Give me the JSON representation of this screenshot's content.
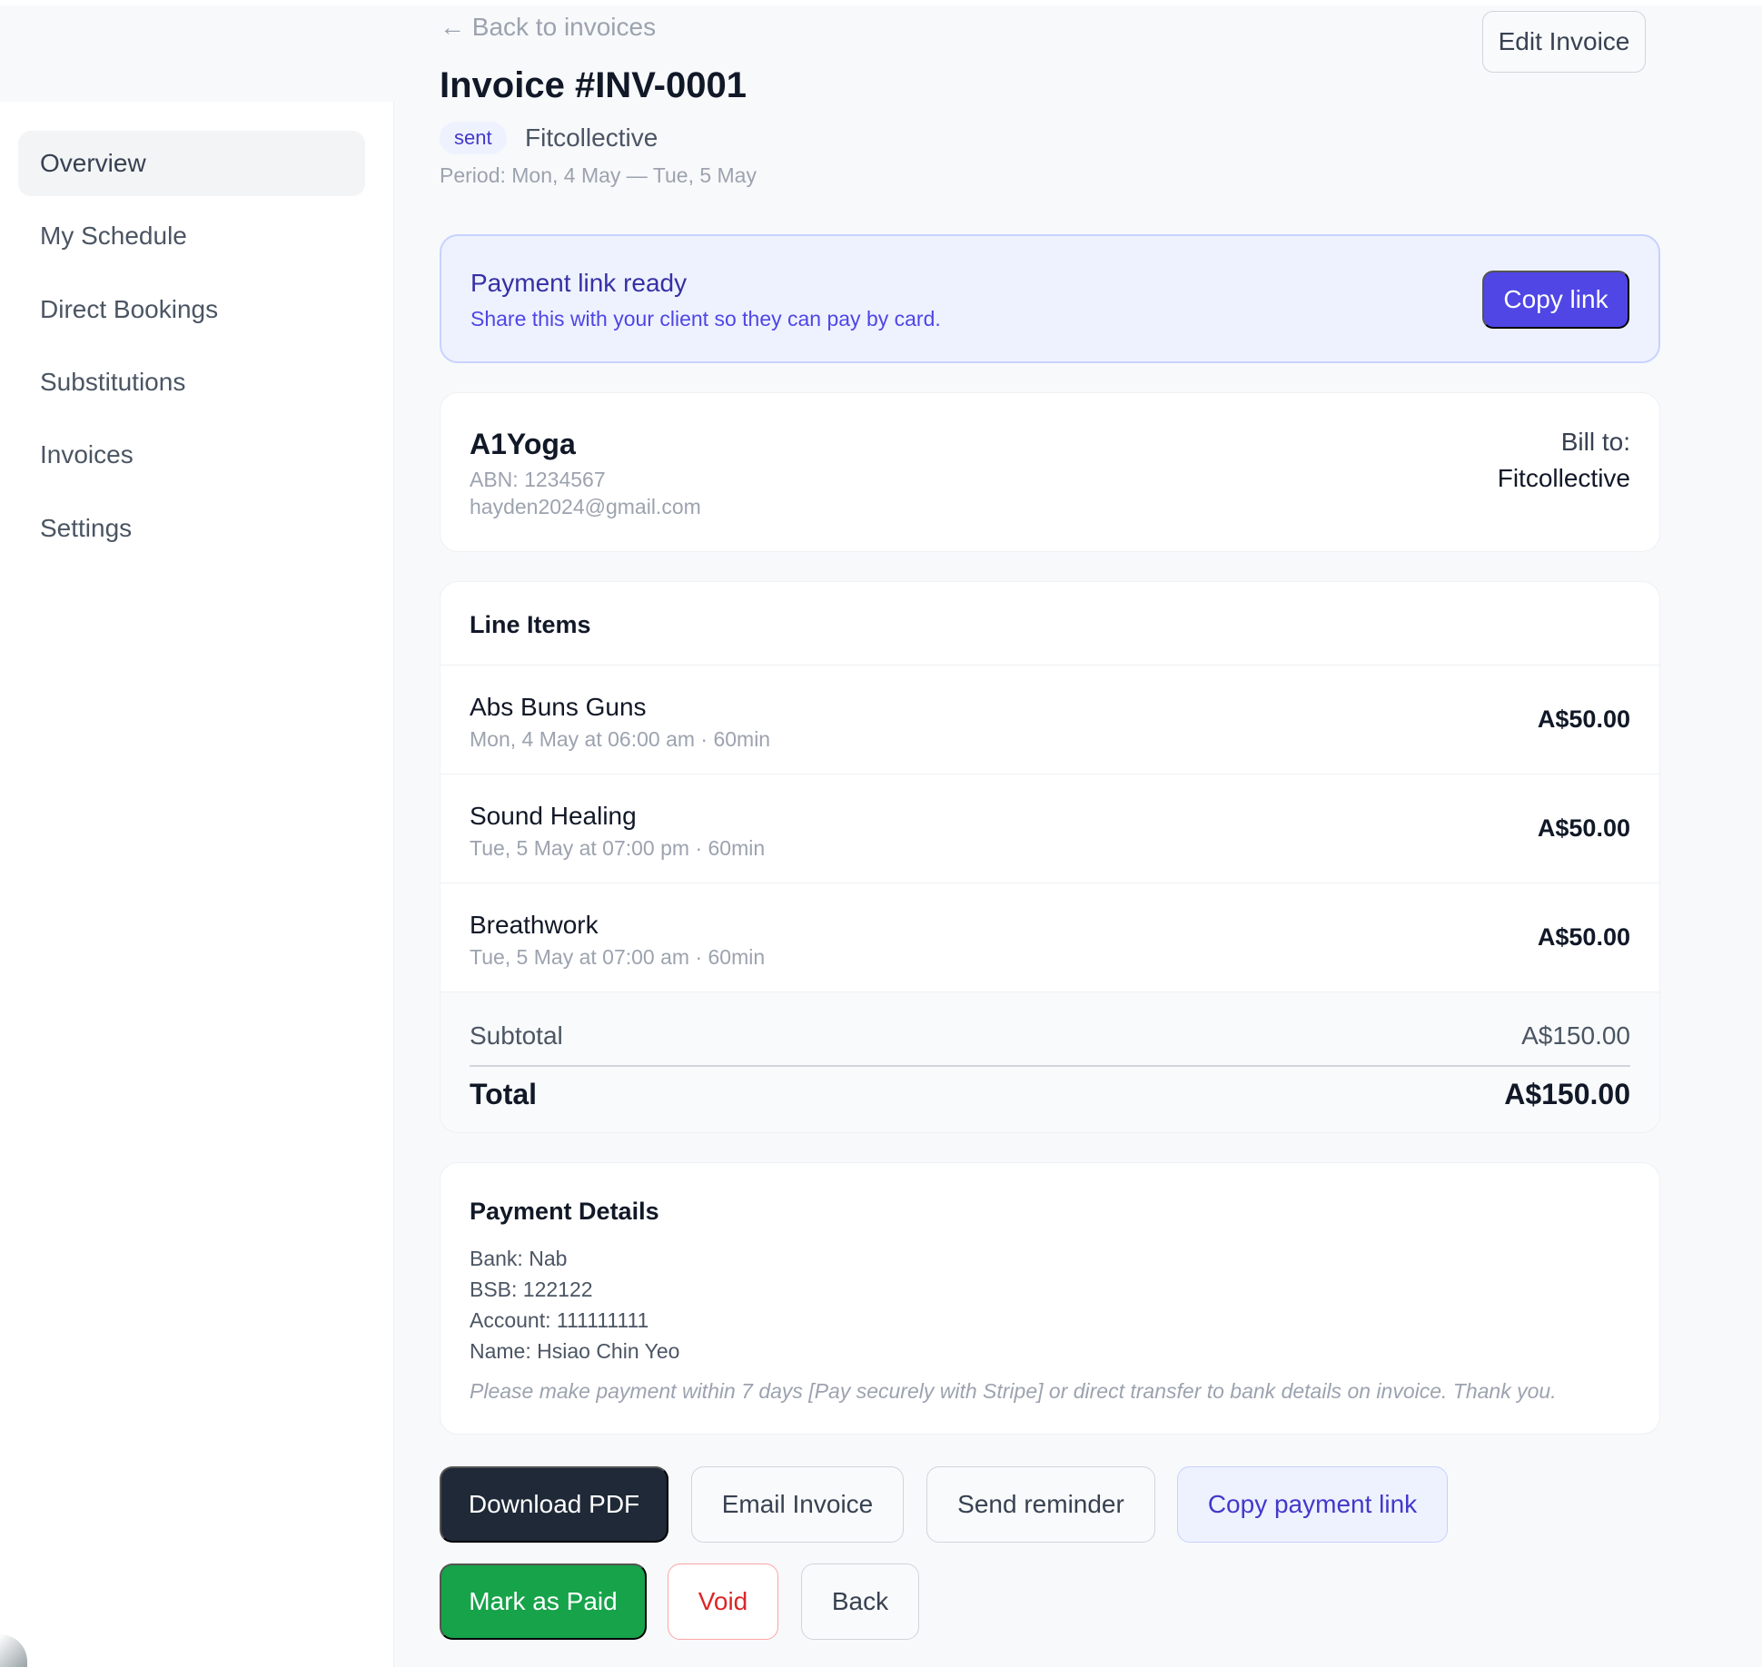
{
  "sidebar": {
    "items": [
      {
        "label": "Overview",
        "active": true
      },
      {
        "label": "My Schedule"
      },
      {
        "label": "Direct Bookings"
      },
      {
        "label": "Substitutions"
      },
      {
        "label": "Invoices"
      },
      {
        "label": "Settings"
      }
    ]
  },
  "header": {
    "back_label": "← Back to invoices",
    "edit_label": "Edit Invoice",
    "title": "Invoice #INV-0001",
    "status": "sent",
    "client": "Fitcollective",
    "period": "Period: Mon, 4 May — Tue, 5 May"
  },
  "banner": {
    "title": "Payment link ready",
    "subtitle": "Share this with your client so they can pay by card.",
    "button": "Copy link"
  },
  "business": {
    "name": "A1Yoga",
    "abn": "ABN: 1234567",
    "email": "hayden2024@gmail.com",
    "bill_label": "Bill to:",
    "bill_name": "Fitcollective"
  },
  "line_items": {
    "title": "Line Items",
    "items": [
      {
        "name": "Abs Buns Guns",
        "meta": "Mon, 4 May at 06:00 am · 60min",
        "amount": "A$50.00"
      },
      {
        "name": "Sound Healing",
        "meta": "Tue, 5 May at 07:00 pm · 60min",
        "amount": "A$50.00"
      },
      {
        "name": "Breathwork",
        "meta": "Tue, 5 May at 07:00 am · 60min",
        "amount": "A$50.00"
      }
    ],
    "subtotal_label": "Subtotal",
    "subtotal_value": "A$150.00",
    "total_label": "Total",
    "total_value": "A$150.00"
  },
  "payment": {
    "title": "Payment Details",
    "bank": "Bank: Nab",
    "bsb": "BSB: 122122",
    "account": "Account: 111111111",
    "name": "Name: Hsiao Chin Yeo",
    "note": "Please make payment within 7 days [Pay securely with Stripe] or direct transfer to bank details on invoice. Thank you."
  },
  "actions": {
    "download_pdf": "Download PDF",
    "email_invoice": "Email Invoice",
    "send_reminder": "Send reminder",
    "copy_payment_link": "Copy payment link",
    "mark_paid": "Mark as Paid",
    "void": "Void",
    "back": "Back"
  }
}
